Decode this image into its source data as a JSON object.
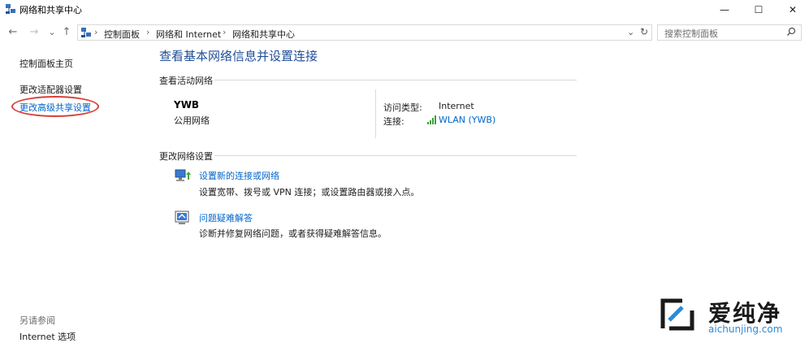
{
  "window": {
    "title": "网络和共享中心",
    "controls": {
      "minimize": "—",
      "maximize": "☐",
      "close": "✕"
    }
  },
  "nav": {
    "back": "←",
    "forward": "→",
    "recent": "⌄",
    "up": "↑",
    "breadcrumbs": [
      "控制面板",
      "网络和 Internet",
      "网络和共享中心"
    ],
    "separator": "›",
    "refresh": "↻",
    "dropdown": "⌄"
  },
  "search": {
    "placeholder": "搜索控制面板"
  },
  "sidebar": {
    "home": "控制面板主页",
    "adapter_settings": "更改适配器设置",
    "advanced_sharing": "更改高级共享设置",
    "see_also": "另请参阅",
    "internet_options": "Internet 选项"
  },
  "main": {
    "title": "查看基本网络信息并设置连接",
    "active_section": "查看活动网络",
    "network": {
      "name": "YWB",
      "type": "公用网络",
      "access_label": "访问类型:",
      "access_value": "Internet",
      "connection_label": "连接:",
      "connection_value": "WLAN (YWB)"
    },
    "change_section": "更改网络设置",
    "tasks": [
      {
        "title": "设置新的连接或网络",
        "desc": "设置宽带、拨号或 VPN 连接；或设置路由器或接入点。"
      },
      {
        "title": "问题疑难解答",
        "desc": "诊断并修复网络问题，或者获得疑难解答信息。"
      }
    ]
  },
  "watermark": {
    "brand": "爱纯净",
    "url": "aichunjing.com"
  },
  "colors": {
    "link": "#0066cc",
    "title": "#1f4e99",
    "highlight_ellipse": "#d8403a",
    "watermark_url": "#2d8ad6"
  }
}
